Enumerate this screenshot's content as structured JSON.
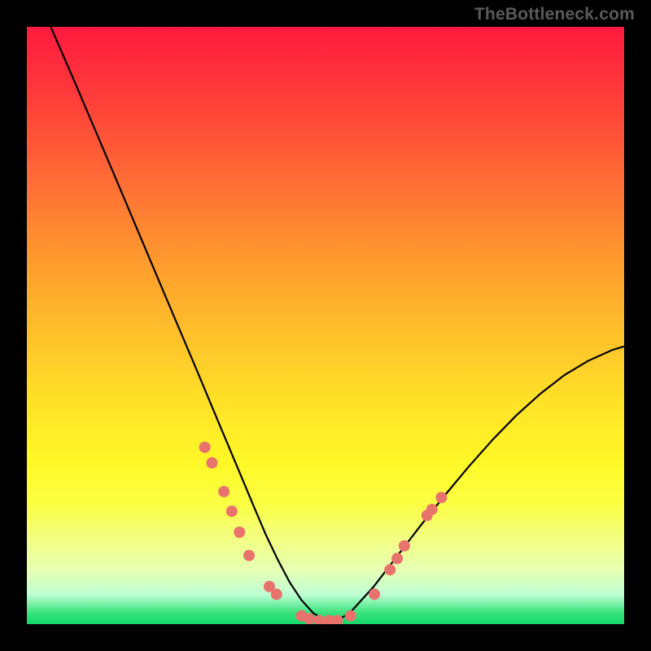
{
  "watermark": "TheBottleneck.com",
  "chart_data": {
    "type": "line",
    "title": "",
    "xlabel": "",
    "ylabel": "",
    "xlim": [
      0,
      100
    ],
    "ylim": [
      0,
      100
    ],
    "grid": false,
    "legend": false,
    "series": [
      {
        "name": "curve",
        "x": [
          4,
          8,
          12,
          16,
          20,
          24,
          28,
          32,
          36,
          38,
          40,
          42,
          44,
          46,
          48,
          50,
          52,
          54,
          58,
          62,
          66,
          70,
          74,
          78,
          82,
          86,
          90,
          94,
          98,
          100
        ],
        "values": [
          100,
          90.8,
          81.4,
          72.0,
          62.5,
          53.0,
          43.6,
          34.0,
          24.5,
          19.7,
          15.0,
          10.8,
          7.0,
          4.0,
          1.8,
          0.7,
          0.7,
          1.8,
          6.2,
          11.4,
          16.6,
          21.6,
          26.4,
          30.9,
          35.0,
          38.6,
          41.7,
          44.1,
          45.9,
          46.5
        ]
      }
    ],
    "markers": [
      {
        "x": 29.8,
        "y": 29.6
      },
      {
        "x": 31.0,
        "y": 27.0
      },
      {
        "x": 33.0,
        "y": 22.2
      },
      {
        "x": 34.3,
        "y": 18.9
      },
      {
        "x": 35.6,
        "y": 15.4
      },
      {
        "x": 37.2,
        "y": 11.5
      },
      {
        "x": 40.6,
        "y": 6.3
      },
      {
        "x": 41.8,
        "y": 5.0
      },
      {
        "x": 46.0,
        "y": 1.4
      },
      {
        "x": 47.3,
        "y": 0.9
      },
      {
        "x": 49.0,
        "y": 0.6
      },
      {
        "x": 50.6,
        "y": 0.6
      },
      {
        "x": 52.0,
        "y": 0.6
      },
      {
        "x": 54.2,
        "y": 1.4
      },
      {
        "x": 58.2,
        "y": 5.0
      },
      {
        "x": 60.8,
        "y": 9.1
      },
      {
        "x": 62.0,
        "y": 11.0
      },
      {
        "x": 63.2,
        "y": 13.1
      },
      {
        "x": 67.0,
        "y": 18.2
      },
      {
        "x": 67.8,
        "y": 19.2
      },
      {
        "x": 69.4,
        "y": 21.2
      }
    ],
    "colors": {
      "curve": "#000000",
      "marker": "#e8736d",
      "gradient_top": "#ff1a3f",
      "gradient_bottom": "#12d96b"
    }
  }
}
